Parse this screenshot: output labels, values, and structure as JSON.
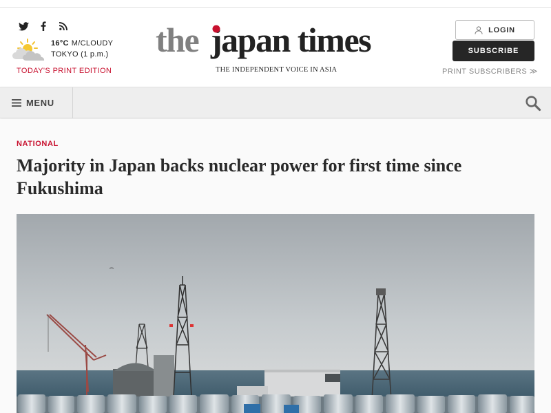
{
  "header": {
    "social": [
      {
        "icon": "twitter-icon"
      },
      {
        "icon": "facebook-icon"
      },
      {
        "icon": "rss-icon"
      }
    ],
    "weather": {
      "icon": "partly-cloudy-icon",
      "temperature": "16°C",
      "condition": "M/CLOUDY",
      "location_time": "TOKYO (1 p.m.)"
    },
    "print_edition_label": "TODAY'S PRINT EDITION",
    "logo_text": "the japan times",
    "tagline": "THE INDEPENDENT VOICE IN ASIA",
    "login_label": "LOGIN",
    "subscribe_label": "SUBSCRIBE",
    "print_subscribers_label": "PRINT SUBSCRIBERS ≫",
    "brand_red": "#c8102e"
  },
  "nav": {
    "menu_label": "MENU",
    "search_icon": "search-icon"
  },
  "article": {
    "category": "NATIONAL",
    "headline": "Majority in Japan backs nuclear power for first time since Fukushima",
    "image_subject": "nuclear-power-plant-photo"
  }
}
